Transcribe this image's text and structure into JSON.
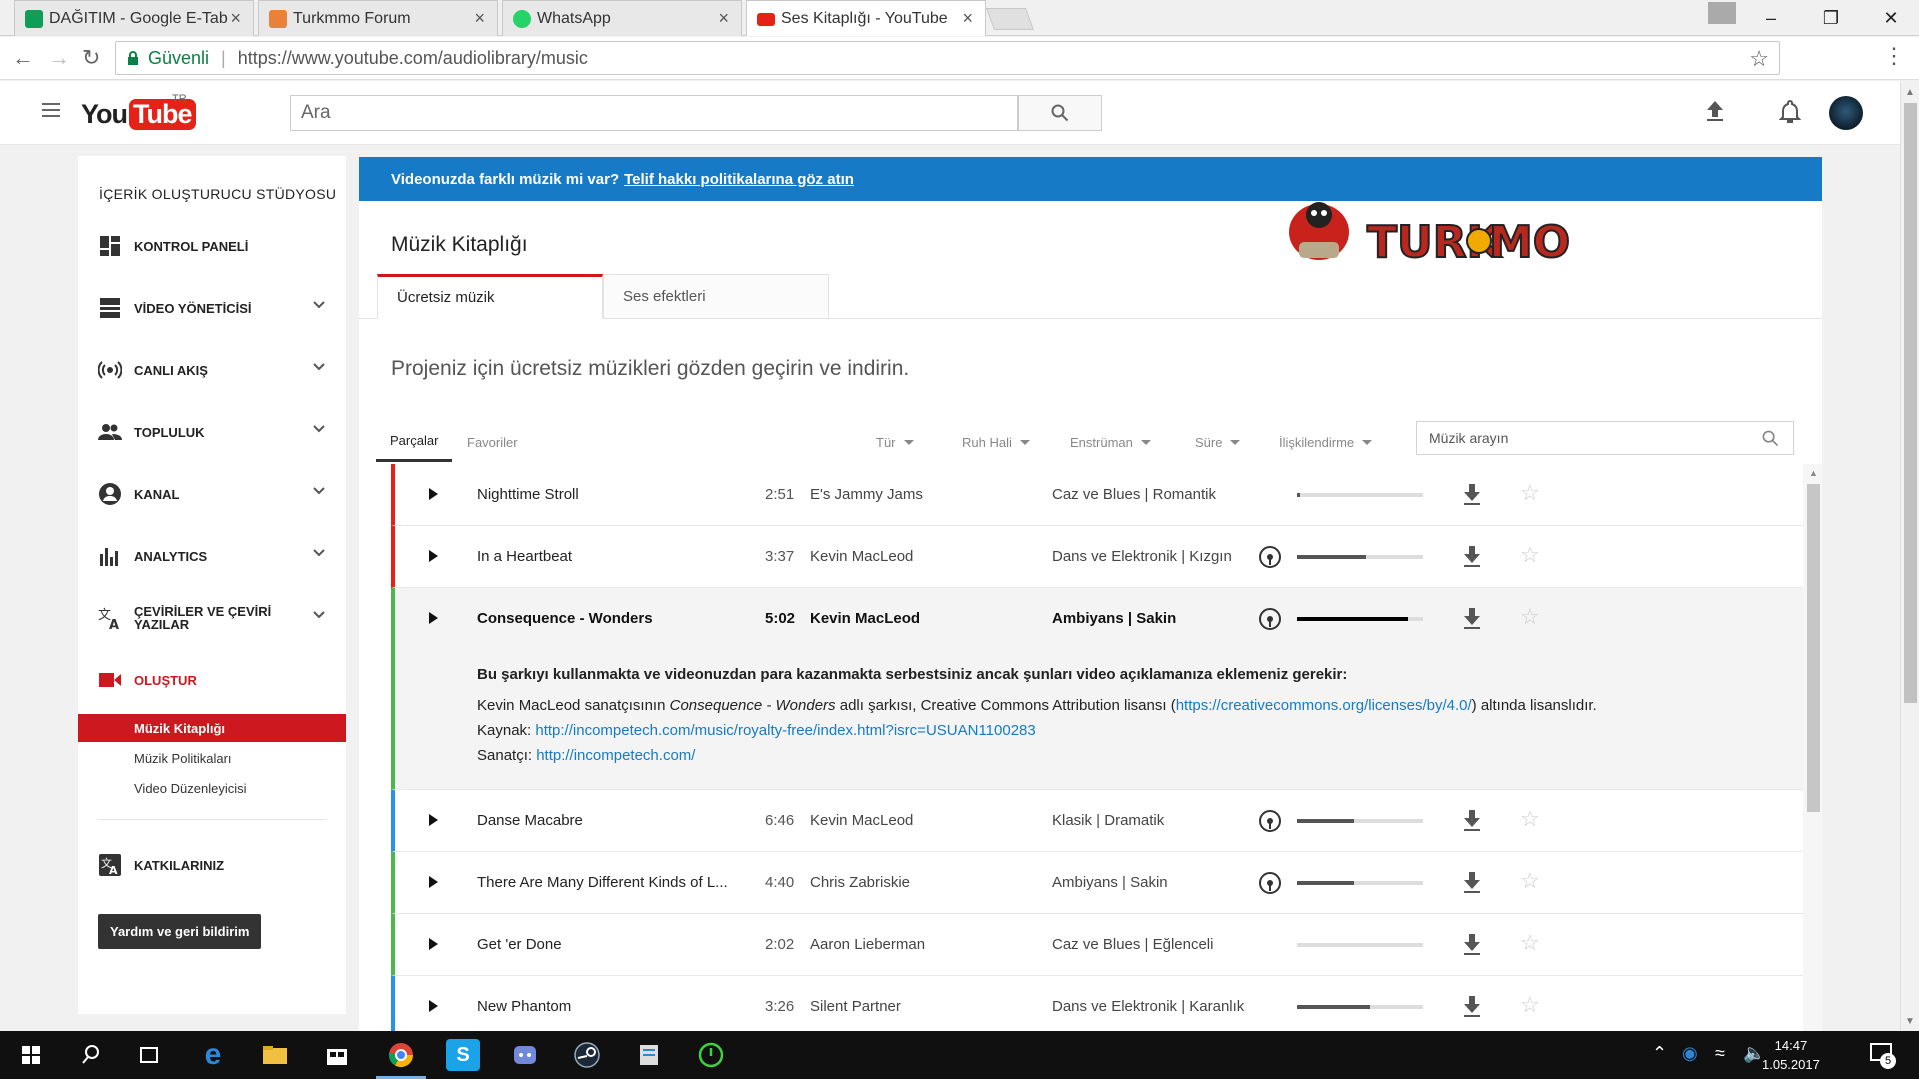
{
  "browser": {
    "tabs": [
      {
        "title": "DAĞITIM - Google E-Tab",
        "color": "#0f9d58"
      },
      {
        "title": "Turkmmo Forum",
        "color": "#e8823a"
      },
      {
        "title": "WhatsApp",
        "color": "#25d366"
      },
      {
        "title": "Ses Kitaplığı - YouTube",
        "color": "#e62117"
      }
    ],
    "secure_label": "Güvenli",
    "url": "https://www.youtube.com/audiolibrary/music"
  },
  "yt": {
    "logo_you": "You",
    "logo_tube": "Tube",
    "region": "TR",
    "search_placeholder": "Ara"
  },
  "sidebar": {
    "title": "İÇERİK OLUŞTURUCU STÜDYOSU",
    "items": [
      {
        "label": "KONTROL PANELİ",
        "icon": "dashboard-icon"
      },
      {
        "label": "VİDEO YÖNETİCİSİ",
        "icon": "video-manager-icon"
      },
      {
        "label": "CANLI AKIŞ",
        "icon": "live-icon"
      },
      {
        "label": "TOPLULUK",
        "icon": "community-icon"
      },
      {
        "label": "KANAL",
        "icon": "channel-icon"
      },
      {
        "label": "ANALYTICS",
        "icon": "analytics-icon"
      },
      {
        "label": "ÇEVİRİLER VE ÇEVİRİ YAZILAR",
        "icon": "translate-icon"
      },
      {
        "label": "OLUŞTUR",
        "icon": "create-icon"
      }
    ],
    "sub_items": [
      "Müzik Kitaplığı",
      "Müzik Politikaları",
      "Video Düzenleyicisi"
    ],
    "contributions": "KATKILARINIZ",
    "help": "Yardım ve geri bildirim"
  },
  "main": {
    "banner_text": "Videonuzda farklı müzik mi var?",
    "banner_link": "Telif hakkı politikalarına göz atın",
    "title": "Müzik Kitaplığı",
    "tabs": [
      "Ücretsiz müzik",
      "Ses efektleri"
    ],
    "subtitle": "Projeniz için ücretsiz müzikleri gözden geçirin ve indirin.",
    "list_tabs": [
      "Parçalar",
      "Favoriler"
    ],
    "filters": [
      "Tür",
      "Ruh Hali",
      "Enstrüman",
      "Süre",
      "İlişkilendirme"
    ],
    "search_placeholder": "Müzik arayın",
    "accent": "#167ac6"
  },
  "tracks": [
    {
      "name": "Nighttime Stroll",
      "duration": "2:51",
      "artist": "E's Jammy Jams",
      "genre": "Caz ve Blues | Romantik",
      "attribution": false,
      "popularity": 0.02,
      "color": "r"
    },
    {
      "name": "In a Heartbeat",
      "duration": "3:37",
      "artist": "Kevin MacLeod",
      "genre": "Dans ve Elektronik | Kızgın",
      "attribution": true,
      "popularity": 0.55,
      "color": "r"
    },
    {
      "name": "Consequence - Wonders",
      "duration": "5:02",
      "artist": "Kevin MacLeod",
      "genre": "Ambiyans | Sakin",
      "attribution": true,
      "popularity": 0.88,
      "color": "g",
      "expanded": true
    },
    {
      "name": "Danse Macabre",
      "duration": "6:46",
      "artist": "Kevin MacLeod",
      "genre": "Klasik | Dramatik",
      "attribution": true,
      "popularity": 0.45,
      "color": "b"
    },
    {
      "name": "There Are Many Different Kinds of L...",
      "duration": "4:40",
      "artist": "Chris Zabriskie",
      "genre": "Ambiyans | Sakin",
      "attribution": true,
      "popularity": 0.45,
      "color": "g"
    },
    {
      "name": "Get 'er Done",
      "duration": "2:02",
      "artist": "Aaron Lieberman",
      "genre": "Caz ve Blues | Eğlenceli",
      "attribution": false,
      "popularity": 0.0,
      "color": "g"
    },
    {
      "name": "New Phantom",
      "duration": "3:26",
      "artist": "Silent Partner",
      "genre": "Dans ve Elektronik | Karanlık",
      "attribution": false,
      "popularity": 0.58,
      "color": "b"
    }
  ],
  "details": {
    "notice": "Bu şarkıyı kullanmakta ve videonuzdan para kazanmakta serbestsiniz ancak şunları video açıklamanıza eklemeniz gerekir:",
    "line1_pre": "Kevin MacLeod sanatçısının ",
    "line1_song": "Consequence - Wonders",
    "line1_mid": " adlı şarkısı, Creative Commons Attribution lisansı (",
    "line1_link": "https://creativecommons.org/licenses/by/4.0/",
    "line1_post": ") altında lisanslıdır.",
    "source_label": "Kaynak: ",
    "source_link": "http://incompetech.com/music/royalty-free/index.html?isrc=USUAN1100283",
    "artist_label": "Sanatçı: ",
    "artist_link": "http://incompetech.com/"
  },
  "taskbar": {
    "time": "14:47",
    "date": "1.05.2017",
    "notifications": "5"
  }
}
